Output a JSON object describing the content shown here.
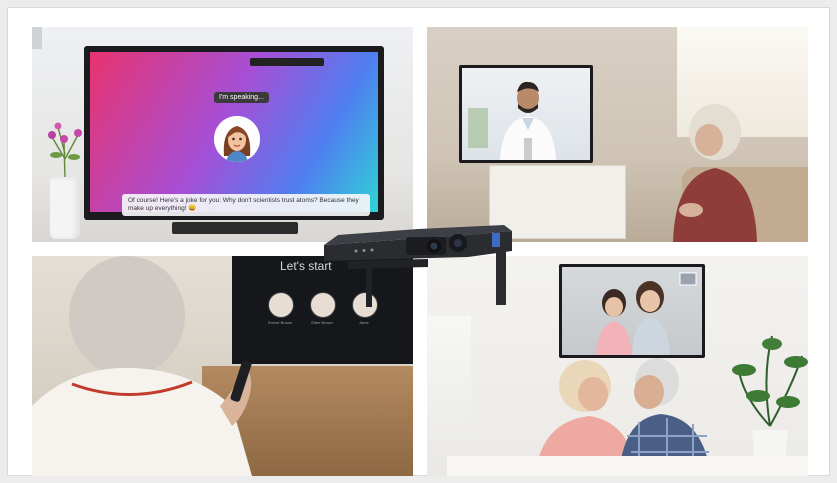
{
  "panel_1": {
    "bubble_text": "I'm speaking...",
    "message_text": "Of course! Here's a joke for you: Why don't scientists trust atoms? Because they make up everything! 😄"
  },
  "panel_3": {
    "screen_title": "Let's start",
    "profiles": [
      "Ernest Brown",
      "Ellen Brown",
      "Anne"
    ]
  },
  "colors": {
    "screen_gradient": [
      "#e8336f",
      "#a64fd6",
      "#4f7ef0",
      "#2fd3d6"
    ],
    "device": "#2a2c30"
  }
}
